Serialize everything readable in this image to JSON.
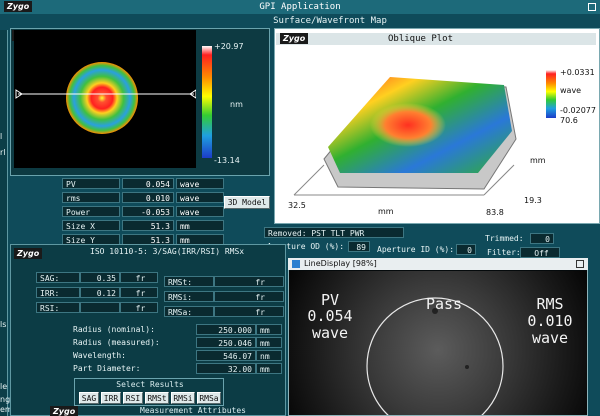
{
  "window": {
    "title": "GPI Application",
    "subtitle": "Surface/Wavefront Map"
  },
  "brand": {
    "logo": "Zygo"
  },
  "edge_labels": [
    "l",
    "rl",
    "ls",
    "le",
    "nges",
    "ement Te"
  ],
  "surface_map": {
    "colorbar": {
      "max": "+20.97",
      "unit": "nm",
      "min": "-13.14"
    },
    "metrics": [
      {
        "label": "PV",
        "value": "0.054",
        "unit": "wave"
      },
      {
        "label": "rms",
        "value": "0.010",
        "unit": "wave"
      },
      {
        "label": "Power",
        "value": "-0.053",
        "unit": "wave"
      },
      {
        "label": "Size X",
        "value": "51.3",
        "unit": "mm"
      },
      {
        "label": "Size Y",
        "value": "51.3",
        "unit": "mm"
      }
    ],
    "model_button": "3D Model"
  },
  "oblique_plot": {
    "title": "Oblique Plot",
    "colorbar": {
      "max": "+0.0331",
      "unit": "wave",
      "min": "-0.02077"
    },
    "z_tick": "70.6",
    "x_axis": {
      "label": "mm",
      "start": "32.5",
      "end": "83.8"
    },
    "y_axis": {
      "label": "mm",
      "value": "19.3"
    }
  },
  "info_bar": {
    "removed": "Removed: PST TLT PWR",
    "trimmed_label": "Trimmed:",
    "trimmed_value": "0",
    "aperture_od_label": "Aperture OD (%):",
    "aperture_od_value": "89",
    "aperture_id_label": "Aperture ID (%):",
    "aperture_id_value": "0",
    "filter_label": "Filter:",
    "filter_value": "Off"
  },
  "sag_panel": {
    "header": "ISO 10110-5: 3/SAG(IRR/RSI) RMSx",
    "left_rows": [
      {
        "label": "SAG:",
        "value": "0.35",
        "unit": "fr"
      },
      {
        "label": "IRR:",
        "value": "0.12",
        "unit": "fr"
      },
      {
        "label": "RSI:",
        "value": "",
        "unit": "fr"
      }
    ],
    "right_rows": [
      {
        "label": "RMSt:",
        "unit": "fr"
      },
      {
        "label": "RMSi:",
        "unit": "fr"
      },
      {
        "label": "RMSa:",
        "unit": "fr"
      }
    ],
    "params": [
      {
        "label": "Radius (nominal):",
        "value": "250.000",
        "unit": "mm"
      },
      {
        "label": "Radius (measured):",
        "value": "250.046",
        "unit": "mm"
      },
      {
        "label": "Wavelength:",
        "value": "546.07",
        "unit": "nm"
      },
      {
        "label": "Part Diameter:",
        "value": "32.00",
        "unit": "mm"
      }
    ],
    "select_results": {
      "title": "Select Results",
      "buttons": [
        "SAG",
        "IRR",
        "RSI",
        "RMSt",
        "RMSi",
        "RMSa"
      ]
    },
    "measurement_attributes": "Measurement Attributes"
  },
  "line_display": {
    "title": "LineDisplay [98%]",
    "pv_label": "PV",
    "pv_value": "0.054",
    "pv_unit": "wave",
    "status": "Pass",
    "rms_label": "RMS",
    "rms_value": "0.010",
    "rms_unit": "wave"
  },
  "colors": {
    "panel_bg": "#0c3c45",
    "pass_status": "#ffffff"
  }
}
